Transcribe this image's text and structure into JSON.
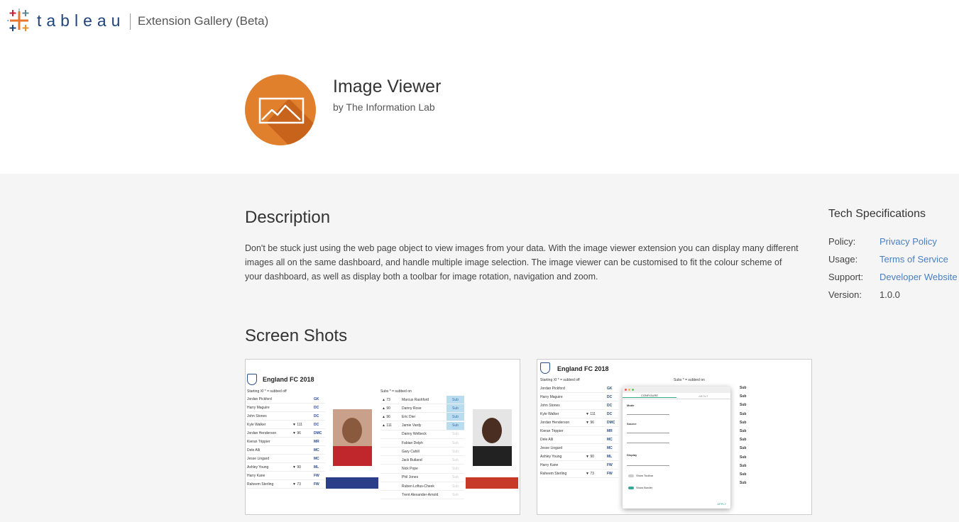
{
  "header": {
    "logo_text": "tableau",
    "app_title": "Extension Gallery (Beta)"
  },
  "extension": {
    "name": "Image Viewer",
    "author": "by The Information Lab",
    "icon": "image-mountain-icon",
    "icon_color": "#e07f2c"
  },
  "description": {
    "heading": "Description",
    "text": "Don't be stuck just using the web page object to view images from your data. With the image viewer extension you can display many different images all on the same dashboard, and handle multiple image selection.  The image viewer can be customised to fit the colour scheme of your dashboard, as well as display both a toolbar for image rotation, navigation and zoom."
  },
  "tech": {
    "heading": "Tech Specifications",
    "rows": [
      {
        "key": "Policy:",
        "value": "Privacy Policy",
        "link": true
      },
      {
        "key": "Usage:",
        "value": "Terms of Service",
        "link": true
      },
      {
        "key": "Support:",
        "value": "Developer Website",
        "link": true
      },
      {
        "key": "Version:",
        "value": "1.0.0",
        "link": false
      }
    ]
  },
  "screenshots": {
    "heading": "Screen Shots",
    "shot1": {
      "title": "England FC 2018",
      "starting_label": "Starting XI  * = subbed off",
      "subs_label": "Subs  * = subbed on",
      "starting": [
        {
          "name": "Jordan Pickford",
          "min": "",
          "pos": "GK"
        },
        {
          "name": "Harry Maguire",
          "min": "",
          "pos": "DC"
        },
        {
          "name": "John Stones",
          "min": "",
          "pos": "DC"
        },
        {
          "name": "Kyle Walker",
          "min": "▼ 111",
          "pos": "DC"
        },
        {
          "name": "Jordan Henderson",
          "min": "▼ 96",
          "pos": "DMC"
        },
        {
          "name": "Kieran Trippier",
          "min": "",
          "pos": "MR"
        },
        {
          "name": "Dele Alli",
          "min": "",
          "pos": "MC"
        },
        {
          "name": "Jesse Lingard",
          "min": "",
          "pos": "MC"
        },
        {
          "name": "Ashley Young",
          "min": "▼ 90",
          "pos": "ML"
        },
        {
          "name": "Harry Kane",
          "min": "",
          "pos": "FW"
        },
        {
          "name": "Raheem Sterling",
          "min": "▼ 73",
          "pos": "FW"
        }
      ],
      "subs": [
        {
          "min": "▲ 73",
          "name": "Marcus Rashford",
          "sub": "Sub",
          "active": true
        },
        {
          "min": "▲ 90",
          "name": "Danny Rose",
          "sub": "Sub",
          "active": true
        },
        {
          "min": "▲ 96",
          "name": "Eric Dier",
          "sub": "Sub",
          "active": true
        },
        {
          "min": "▲ 111",
          "name": "Jamie Vardy",
          "sub": "Sub",
          "active": true
        },
        {
          "min": "",
          "name": "Danny Welbeck",
          "sub": "Sub",
          "active": false
        },
        {
          "min": "",
          "name": "Fabian Delph",
          "sub": "Sub",
          "active": false
        },
        {
          "min": "",
          "name": "Gary Cahill",
          "sub": "Sub",
          "active": false
        },
        {
          "min": "",
          "name": "Jack Butland",
          "sub": "Sub",
          "active": false
        },
        {
          "min": "",
          "name": "Nick Pope",
          "sub": "Sub",
          "active": false
        },
        {
          "min": "",
          "name": "Phil Jones",
          "sub": "Sub",
          "active": false
        },
        {
          "min": "",
          "name": "Ruben Loftus-Cheek",
          "sub": "Sub",
          "active": false
        },
        {
          "min": "",
          "name": "Trent Alexander-Arnold",
          "sub": "Sub",
          "active": false
        }
      ]
    },
    "shot2": {
      "title": "England FC 2018",
      "starting_label": "Starting XI  * = subbed off",
      "subs_label": "Subs  * = subbed on",
      "starting": [
        {
          "name": "Jordan Pickford",
          "min": "",
          "pos": "GK"
        },
        {
          "name": "Harry Maguire",
          "min": "",
          "pos": "DC"
        },
        {
          "name": "John Stones",
          "min": "",
          "pos": "DC"
        },
        {
          "name": "Kyle Walker",
          "min": "▼ 111",
          "pos": "DC"
        },
        {
          "name": "Jordan Henderson",
          "min": "▼ 96",
          "pos": "DMC"
        },
        {
          "name": "Kieran Trippier",
          "min": "",
          "pos": "MR"
        },
        {
          "name": "Dele Alli",
          "min": "",
          "pos": "MC"
        },
        {
          "name": "Jesse Lingard",
          "min": "",
          "pos": "MC"
        },
        {
          "name": "Ashley Young",
          "min": "▼ 90",
          "pos": "ML"
        },
        {
          "name": "Harry Kane",
          "min": "",
          "pos": "FW"
        },
        {
          "name": "Raheem Sterling",
          "min": "▼ 73",
          "pos": "FW"
        }
      ],
      "dialog_tab_active": "CONFIGURE",
      "dialog_tab_other": "ABOUT",
      "dialog_sections": [
        "Mode",
        "Source",
        "Display"
      ],
      "dialog_toggle_1": "Show Toolbar",
      "dialog_toggle_2": "Show Border",
      "dialog_button": "APPLY"
    }
  }
}
